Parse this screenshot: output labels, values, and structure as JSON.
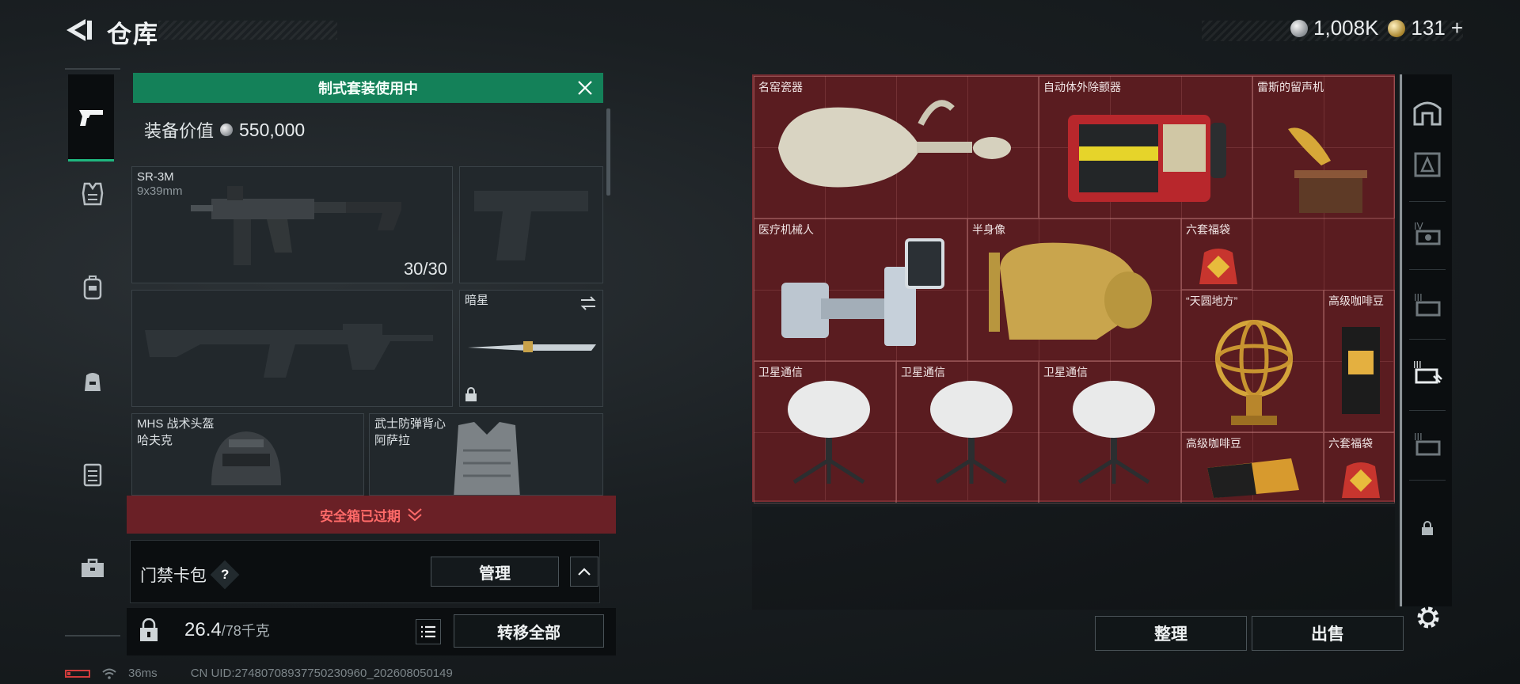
{
  "header": {
    "title": "仓库",
    "currencies": [
      {
        "icon": "silver-coin-icon",
        "value": "1,008K"
      },
      {
        "icon": "gold-coin-icon",
        "value": "131",
        "suffix": "+"
      }
    ]
  },
  "left_nav": {
    "items": [
      {
        "name": "weapons",
        "icon": "pistol-icon",
        "active": true
      },
      {
        "name": "gear",
        "icon": "armor-icon"
      },
      {
        "name": "backpack",
        "icon": "backpack-icon"
      },
      {
        "name": "pouch",
        "icon": "pouch-icon"
      },
      {
        "name": "rig",
        "icon": "chest-rig-icon"
      },
      {
        "name": "case",
        "icon": "briefcase-icon"
      }
    ]
  },
  "loadout": {
    "preset_banner": "制式套装使用中",
    "equip_value_label": "装备价值",
    "equip_value": "550,000",
    "primary": {
      "name": "SR-3M",
      "caliber": "9x39mm",
      "ammo": "30/30"
    },
    "melee": {
      "name": "暗星"
    },
    "helmet": {
      "name": "MHS 战术头盔",
      "sub": "哈夫克"
    },
    "armor": {
      "name": "武士防弹背心",
      "sub": "阿萨拉"
    },
    "safe_box_status": "安全箱已过期",
    "keycard_label": "门禁卡包",
    "help": "?",
    "manage": "管理",
    "weight_current": "26.4",
    "weight_max": "/78千克",
    "transfer_all": "转移全部"
  },
  "storage": {
    "items": [
      {
        "name": "名窑瓷器"
      },
      {
        "name": "自动体外除颤器"
      },
      {
        "name": "雷斯的留声机"
      },
      {
        "name": "医疗机械人"
      },
      {
        "name": "半身像"
      },
      {
        "name": "六套福袋"
      },
      {
        "name": "“天圆地方”"
      },
      {
        "name": "高级咖啡豆"
      },
      {
        "name": "卫星通信"
      },
      {
        "name": "卫星通信"
      },
      {
        "name": "卫星通信"
      },
      {
        "name": "高级咖啡豆"
      },
      {
        "name": "六套福袋"
      }
    ],
    "sort": "整理",
    "sell": "出售"
  },
  "status": {
    "ping": "36ms",
    "uid": "CN UID:2748070893775023096​0_202608050149"
  },
  "colors": {
    "accent": "#148159",
    "danger": "#6a2026",
    "storage_bg": "#5a1c20"
  }
}
